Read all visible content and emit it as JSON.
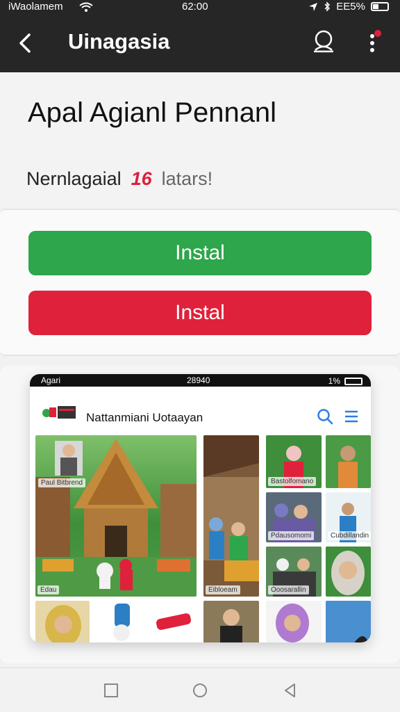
{
  "status_bar": {
    "carrier": "iWaolamem",
    "time": "62:00",
    "battery": "EE5%"
  },
  "app_bar": {
    "title": "Uinagasia"
  },
  "app": {
    "name": "Apal Agianl Pennanl",
    "developer": "Nernlagaial",
    "tag": "16",
    "rating_text": "latars!"
  },
  "buttons": {
    "install_primary": "Instal",
    "install_secondary": "Instal"
  },
  "preview": {
    "status": {
      "carrier": "Agari",
      "time": "28940",
      "battery": "1%"
    },
    "title": "Nattanmiani Uotaayan",
    "tiles": [
      {
        "caption": "Paul Bitbrend"
      },
      {
        "caption": "Edau"
      },
      {
        "caption": "Eibloeam"
      },
      {
        "caption": "Bastolfomano"
      },
      {
        "caption": "Pdausomomi"
      },
      {
        "caption": "Cubdillandin"
      },
      {
        "caption": "Ooosarallin"
      }
    ]
  },
  "colors": {
    "install_green": "#2ea64b",
    "install_red": "#e0213b",
    "appbar": "#262626"
  }
}
